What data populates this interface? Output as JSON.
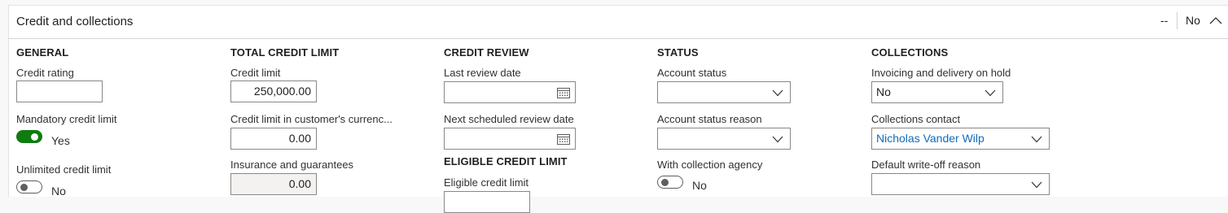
{
  "header": {
    "title": "Credit and collections",
    "summary_dash": "--",
    "summary_no": "No"
  },
  "general": {
    "title": "GENERAL",
    "credit_rating_label": "Credit rating",
    "credit_rating_value": "",
    "mandatory_label": "Mandatory credit limit",
    "mandatory_value": "Yes",
    "unlimited_label": "Unlimited credit limit",
    "unlimited_value": "No"
  },
  "total_credit": {
    "title": "TOTAL CREDIT LIMIT",
    "credit_limit_label": "Credit limit",
    "credit_limit_value": "250,000.00",
    "currency_label": "Credit limit in customer's currenc...",
    "currency_value": "0.00",
    "insurance_label": "Insurance and guarantees",
    "insurance_value": "0.00"
  },
  "credit_review": {
    "title": "CREDIT REVIEW",
    "last_review_label": "Last review date",
    "last_review_value": "",
    "next_review_label": "Next scheduled review date",
    "next_review_value": ""
  },
  "eligible": {
    "title": "ELIGIBLE CREDIT LIMIT",
    "eligible_label": "Eligible credit limit"
  },
  "status": {
    "title": "STATUS",
    "account_status_label": "Account status",
    "account_status_value": "",
    "reason_label": "Account status reason",
    "reason_value": "",
    "agency_label": "With collection agency",
    "agency_value": "No"
  },
  "collections": {
    "title": "COLLECTIONS",
    "hold_label": "Invoicing and delivery on hold",
    "hold_value": "No",
    "contact_label": "Collections contact",
    "contact_value": "Nicholas Vander Wilp",
    "writeoff_label": "Default write-off reason",
    "writeoff_value": ""
  },
  "colors": {
    "toggle_on": "#107c10",
    "link": "#0f6cbd"
  }
}
